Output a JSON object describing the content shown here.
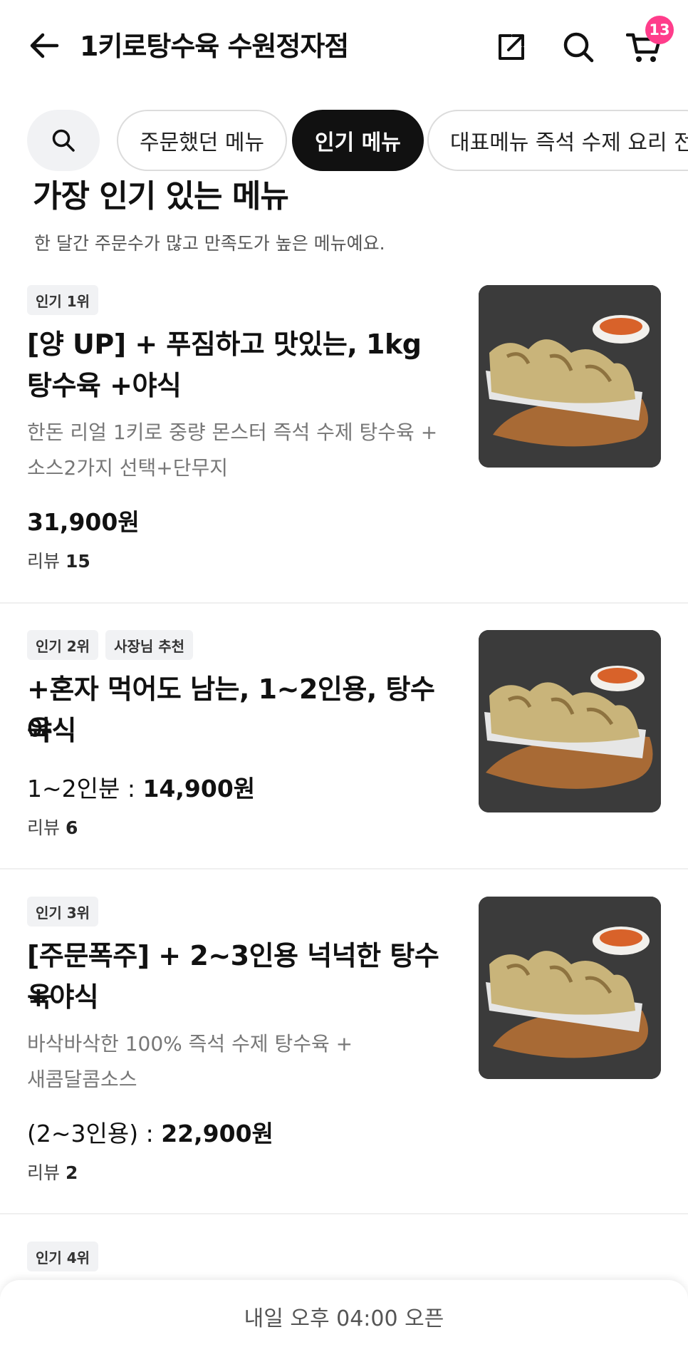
{
  "header": {
    "title": "1키로탕수육 수원정자점",
    "cart_count": "13"
  },
  "tabs": {
    "items": [
      "주문했던 메뉴",
      "인기 메뉴",
      "대표메뉴 즉석 수제 요리 전"
    ]
  },
  "section": {
    "title": "가장 인기 있는 메뉴",
    "subtitle": "한 달간 주문수가 많고 만족도가 높은 메뉴예요."
  },
  "menu": [
    {
      "badges": [
        "인기 1위"
      ],
      "name_line1": "[양 UP] + 푸짐하고 맛있는, 1kg",
      "name_line2": "탕수육 +야식",
      "desc_line1": "한돈 리얼 1키로 중량 몬스터 즉석 수제 탕수육 +",
      "desc_line2": "소스2가지 선택+단무지",
      "price_prefix": "",
      "price": "31,900원",
      "review_label": "리뷰",
      "review_count": "15"
    },
    {
      "badges": [
        "인기 2위",
        "사장님 추천"
      ],
      "name_line1": "+혼자 먹어도 남는, 1~2인용, 탕수육",
      "name_line2": "야식",
      "desc_line1": "",
      "desc_line2": "",
      "price_prefix": "1~2인분 : ",
      "price": "14,900원",
      "review_label": "리뷰",
      "review_count": "6"
    },
    {
      "badges": [
        "인기 3위"
      ],
      "name_line1": "[주문폭주] + 2~3인용 넉넉한 탕수육",
      "name_line2": "+야식",
      "desc_line1": "바삭바삭한  100% 즉석 수제 탕수육 +",
      "desc_line2": "새콤달콤소스",
      "price_prefix": "(2~3인용) : ",
      "price": "22,900원",
      "review_label": "리뷰",
      "review_count": "2"
    },
    {
      "badges": [
        "인기 4위"
      ]
    }
  ],
  "bottom_bar": {
    "status": "내일 오후 04:00 오픈"
  }
}
